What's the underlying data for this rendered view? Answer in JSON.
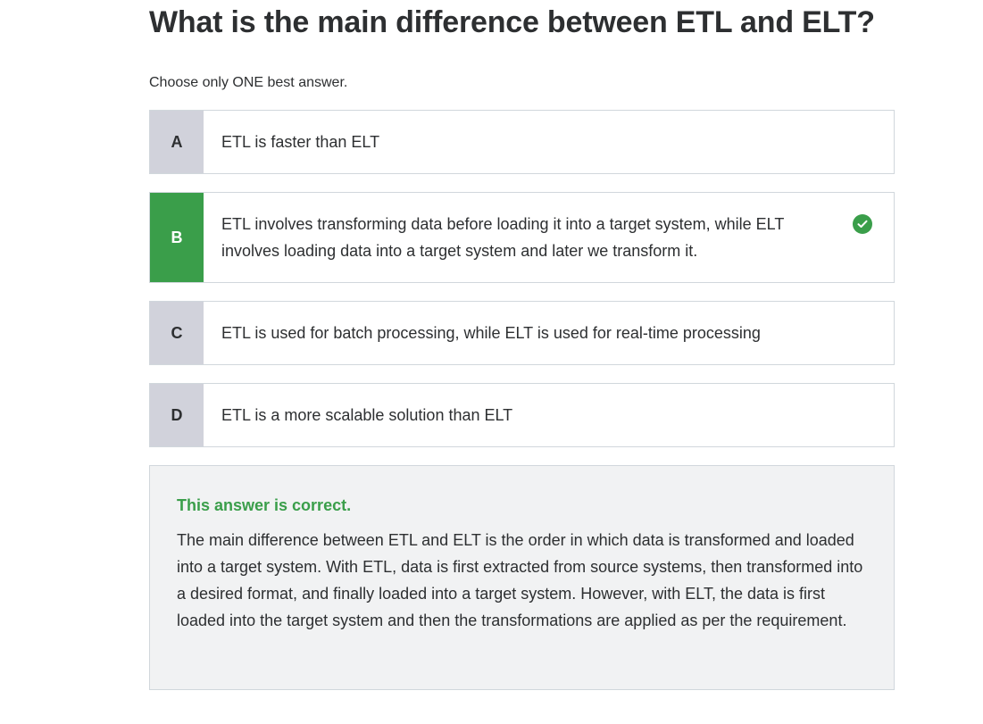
{
  "question": {
    "title": "What is the main difference between ETL and ELT?",
    "instruction": "Choose only ONE best answer."
  },
  "options": [
    {
      "letter": "A",
      "text": "ETL is faster than ELT",
      "state": "neutral"
    },
    {
      "letter": "B",
      "text": "ETL involves transforming data before loading it into a target system, while ELT involves loading data into a target system and later we transform it.",
      "state": "correct"
    },
    {
      "letter": "C",
      "text": "ETL is used for batch processing, while ELT is used for real-time processing",
      "state": "neutral"
    },
    {
      "letter": "D",
      "text": "ETL is a more scalable solution than ELT",
      "state": "neutral"
    }
  ],
  "explanation": {
    "result": "This answer is correct.",
    "body": "The main difference between ETL and ELT is the order in which data is transformed and loaded into a target system. With ETL, data is first extracted from source systems, then transformed into a desired format, and finally loaded into a target system. However, with ELT, the data is first loaded into the target system and then the transformations are applied as per the requirement."
  },
  "icons": {
    "correct": "check-circle-icon"
  },
  "colors": {
    "correct_green": "#3a9e4a",
    "letter_bg": "#d1d2db",
    "explanation_bg": "#f1f2f3",
    "border": "#d1d7dc",
    "text": "#2d2f31"
  }
}
